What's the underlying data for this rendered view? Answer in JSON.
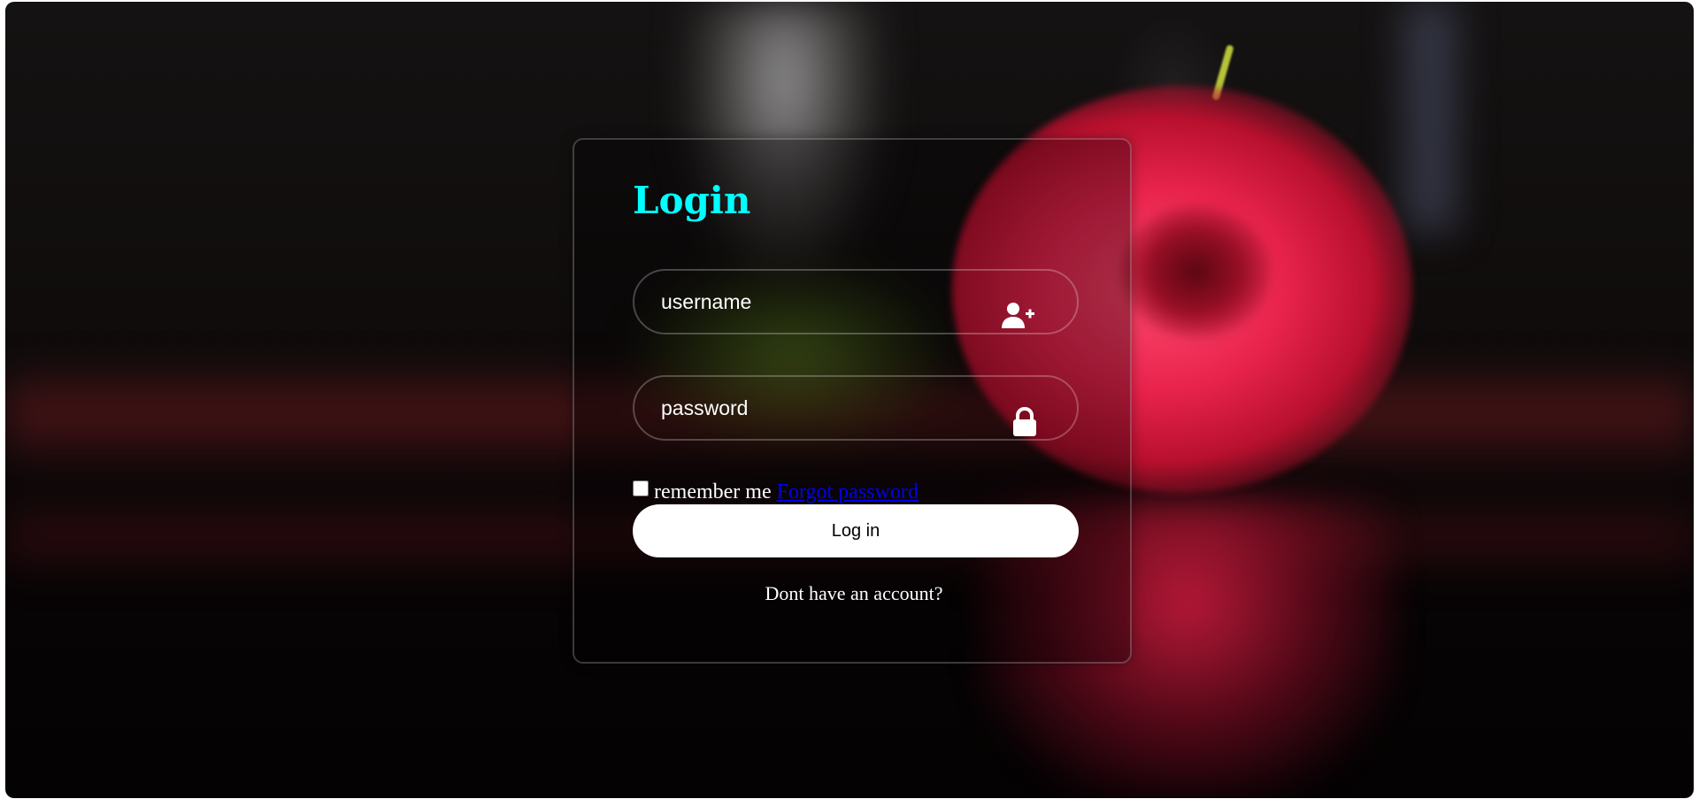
{
  "login": {
    "title": "Login",
    "username_placeholder": "username",
    "password_placeholder": "password",
    "remember_label": "remember me",
    "forgot_link": "Forgot password",
    "submit_label": "Log in",
    "signup_text": "Dont have an account?"
  },
  "icons": {
    "username": "user-plus-icon",
    "password": "lock-icon"
  },
  "colors": {
    "title": "#00ffff",
    "button_bg": "#ffffff",
    "link": "#0000ee"
  }
}
